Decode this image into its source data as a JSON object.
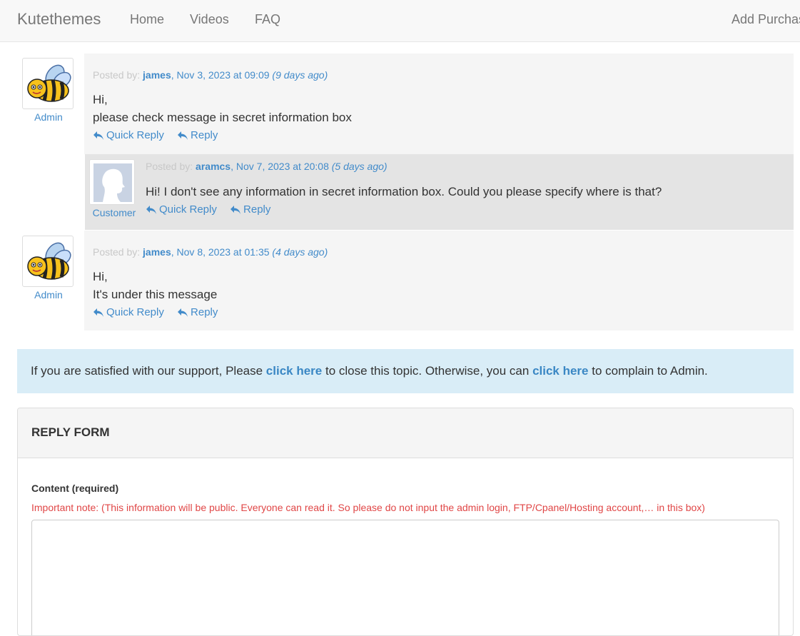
{
  "navbar": {
    "brand": "Kutethemes",
    "links": [
      "Home",
      "Videos",
      "FAQ"
    ],
    "right_link": "Add Purchas"
  },
  "posts": [
    {
      "role": "Admin",
      "avatar_icon": "bee-icon",
      "posted_by_label": "Posted by:",
      "author": "james",
      "date": ", Nov 3, 2023 at 09:09",
      "ago": "(9 days ago)",
      "lines": [
        "Hi,",
        "please check message in secret information box"
      ],
      "quick_reply": "Quick Reply",
      "reply": "Reply"
    },
    {
      "role": "Customer",
      "avatar_icon": "default-user-silhouette-icon",
      "posted_by_label": "Posted by:",
      "author": "aramcs",
      "date": ", Nov 7, 2023 at 20:08",
      "ago": "(5 days ago)",
      "lines": [
        "Hi! I don't see any information in secret information box. Could you please specify where is that?"
      ],
      "quick_reply": "Quick Reply",
      "reply": "Reply"
    },
    {
      "role": "Admin",
      "avatar_icon": "bee-icon",
      "posted_by_label": "Posted by:",
      "author": "james",
      "date": ", Nov 8, 2023 at 01:35",
      "ago": "(4 days ago)",
      "lines": [
        "Hi,",
        "It's under this message"
      ],
      "quick_reply": "Quick Reply",
      "reply": "Reply"
    }
  ],
  "notice": {
    "text1": "If you are satisfied with our support, Please ",
    "link1": "click here",
    "text2": " to close this topic. Otherwise, you can ",
    "link2": "click here",
    "text3": " to complain to Admin."
  },
  "reply_form": {
    "title": "REPLY FORM",
    "content_label": "Content (required)",
    "note": "Important note: (This information will be public. Everyone can read it. So please do not input the admin login, FTP/Cpanel/Hosting account,… in this box)",
    "content_value": ""
  },
  "colors": {
    "link": "#428bca",
    "notice_bg": "#d9edf7",
    "note_red": "#e04646"
  }
}
